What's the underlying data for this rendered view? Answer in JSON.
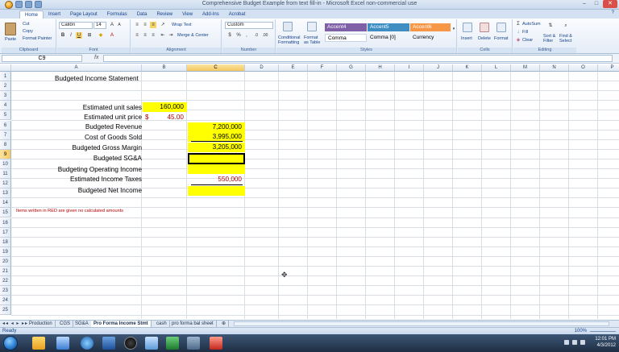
{
  "window": {
    "title": "Comprehensive Budget Example from text fill-in - Microsoft Excel non-commercial use",
    "controls": [
      "–",
      "□",
      "✕"
    ]
  },
  "ribbon_tabs": [
    "Home",
    "Insert",
    "Page Layout",
    "Formulas",
    "Data",
    "Review",
    "View",
    "Add-Ins",
    "Acrobat"
  ],
  "ribbon": {
    "clipboard": {
      "paste": "Paste",
      "cut": "Cut",
      "copy": "Copy",
      "format_painter": "Format Painter",
      "label": "Clipboard"
    },
    "font": {
      "name": "Calibri",
      "size": "14",
      "label": "Font"
    },
    "alignment": {
      "wrap_text": "Wrap Text",
      "merge_center": "Merge & Center",
      "label": "Alignment"
    },
    "number": {
      "format": "Custom",
      "label": "Number"
    },
    "styles": {
      "conditional": "Conditional Formatting",
      "format_table": "Format as Table",
      "accent4": "Accent4",
      "accent5": "Accent5",
      "accent6": "Accent6",
      "comma": "Comma",
      "comma0": "Comma [0]",
      "currency": "Currency",
      "label": "Styles",
      "colors": {
        "accent4": "#7e5fa8",
        "accent5": "#3e8ec4",
        "accent6": "#f79646"
      }
    },
    "cells": {
      "insert": "Insert",
      "delete": "Delete",
      "format": "Format",
      "label": "Cells"
    },
    "editing": {
      "autosum": "AutoSum",
      "fill": "Fill",
      "clear": "Clear",
      "sort_filter": "Sort & Filter",
      "find_select": "Find & Select",
      "label": "Editing"
    }
  },
  "formula_bar": {
    "name_box": "C9",
    "fx": "fx",
    "formula": ""
  },
  "columns": [
    "A",
    "B",
    "C",
    "D",
    "E",
    "F",
    "G",
    "H",
    "I",
    "J",
    "K",
    "L",
    "M",
    "N",
    "O",
    "P"
  ],
  "rows": [
    "1",
    "2",
    "3",
    "4",
    "5",
    "6",
    "7",
    "8",
    "9",
    "10",
    "11",
    "12",
    "13",
    "14",
    "15",
    "16",
    "17",
    "18",
    "19",
    "20",
    "21",
    "22",
    "23",
    "24",
    "25"
  ],
  "cells": {
    "a1": "Budgeted Income Statement",
    "a4": "Estimated unit sales",
    "b4": "160,000",
    "a5": "Estimated unit price",
    "b5_symbol": "$",
    "b5": "45.00",
    "a6": "Budgeted Revenue",
    "c6": "7,200,000",
    "a7": "Cost of Goods Sold",
    "c7": "3,995,000",
    "a8": "Budgeted Gross Margin",
    "c8": "3,205,000",
    "a9": "Budgeted SG&A",
    "a10": "Budgeting Operating Income",
    "a11": "Estimated Income Taxes",
    "c11": "550,000",
    "a12": "Budgeted Net Income",
    "a14": "Items written in RED are given no calculated amounts"
  },
  "sheet_tabs": [
    "Production",
    "CGS",
    "SG&A",
    "Pro Forma Income Stmt",
    "cash",
    "pro forma bal sheet"
  ],
  "active_sheet": "Pro Forma Income Stmt",
  "status": {
    "mode": "Ready",
    "zoom": "100%"
  },
  "taskbar": {
    "time": "12:01 PM",
    "date": "4/3/2012"
  }
}
